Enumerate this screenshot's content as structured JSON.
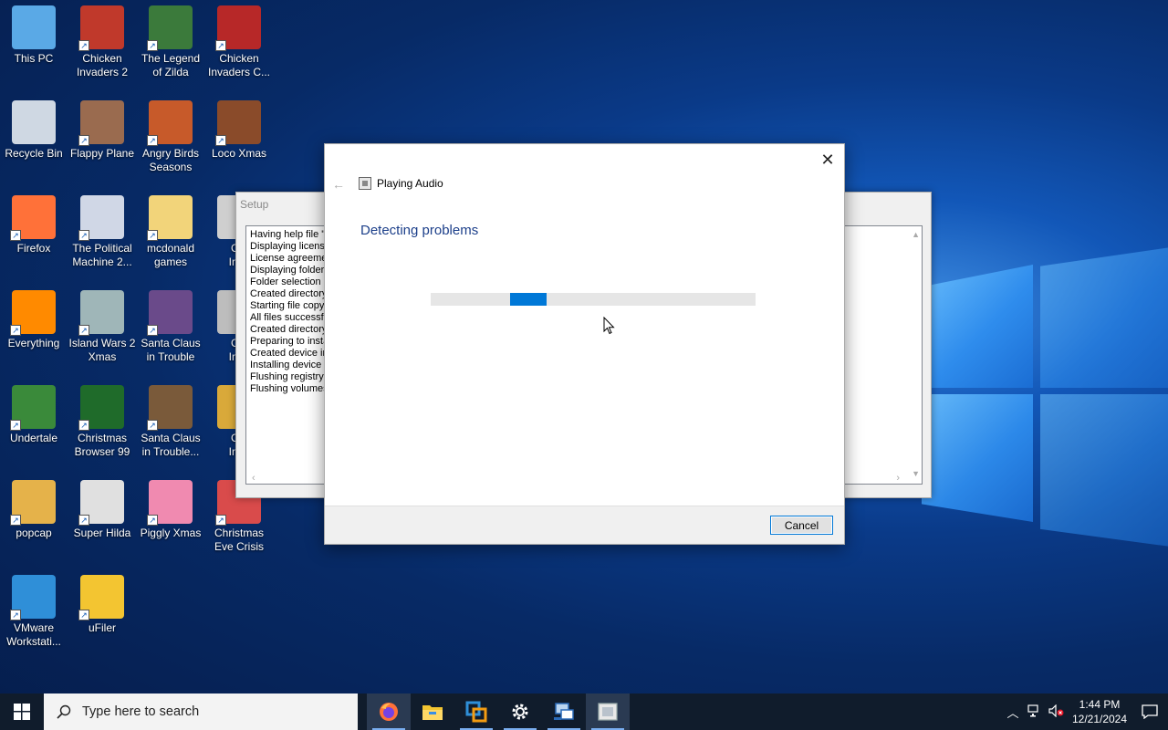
{
  "desktop": {
    "icons": [
      {
        "label": "This PC",
        "icon": "computer-icon",
        "color": "#5aa9e6"
      },
      {
        "label": "Chicken Invaders 2",
        "icon": "chicken-game-icon",
        "color": "#c0392b"
      },
      {
        "label": "The Legend of Zilda",
        "icon": "zilda-game-icon",
        "color": "#3b7a3b"
      },
      {
        "label": "Chicken Invaders C...",
        "icon": "chicken-game-icon",
        "color": "#b72828"
      },
      {
        "label": "Recycle Bin",
        "icon": "recycle-bin-icon",
        "color": "#cfd8e3"
      },
      {
        "label": "Flappy Plane",
        "icon": "plane-game-icon",
        "color": "#9a6b4f"
      },
      {
        "label": "Angry Birds Seasons",
        "icon": "angry-birds-icon",
        "color": "#c75a2a"
      },
      {
        "label": "Loco Xmas",
        "icon": "bear-game-icon",
        "color": "#8a4b2a"
      },
      {
        "label": "Firefox",
        "icon": "firefox-icon",
        "color": "#ff7139"
      },
      {
        "label": "The Political Machine 2...",
        "icon": "political-game-icon",
        "color": "#d0d7e6"
      },
      {
        "label": "mcdonald games",
        "icon": "folder-icon",
        "color": "#f2d47a"
      },
      {
        "label": "Everything",
        "icon": "search-magnifier-icon",
        "color": "#ff8a00"
      },
      {
        "label": "Island Wars 2 Xmas",
        "icon": "island-game-icon",
        "color": "#9fb6b8"
      },
      {
        "label": "Santa Claus in Trouble",
        "icon": "santa-game-icon",
        "color": "#6a4a8a"
      },
      {
        "label": "Undertale",
        "icon": "undertale-icon",
        "color": "#3a8a3a"
      },
      {
        "label": "Christmas Browser 99",
        "icon": "xmas-tree-icon",
        "color": "#1f6b2a"
      },
      {
        "label": "Santa Claus in Trouble...",
        "icon": "santa-game-icon",
        "color": "#7a5a3a"
      },
      {
        "label": "popcap",
        "icon": "folder-icon",
        "color": "#e5b24a"
      },
      {
        "label": "Super Hilda",
        "icon": "hilda-game-icon",
        "color": "#e0e0e0"
      },
      {
        "label": "Piggly Xmas",
        "icon": "pig-game-icon",
        "color": "#f08ab0"
      },
      {
        "label": "Christmas Eve Crisis",
        "icon": "santa-game-icon",
        "color": "#d94b4b"
      },
      {
        "label": "VMware Workstati...",
        "icon": "vmware-icon",
        "color": "#2f8fd8"
      },
      {
        "label": "uFiler",
        "icon": "ufiler-folder-icon",
        "color": "#f3c531"
      }
    ],
    "partial_icons": [
      {
        "label": "Chi\nInva",
        "color": "#cfcfcf"
      },
      {
        "label": "Chi\nInva",
        "color": "#bdbdbd"
      },
      {
        "label": "Chi\nInva",
        "color": "#d9a93a"
      }
    ]
  },
  "setup_window": {
    "title": "Setup",
    "log_lines": [
      "Having help file \"\\",
      "Displaying license",
      "License agreemer",
      "Displaying folder",
      "Folder selection s",
      "Created directory",
      "Starting file copy",
      "All files successfu",
      "Created directory",
      "Preparing to insta",
      "Created device in",
      "Installing device c",
      "Flushing registry",
      "Flushing volumes"
    ]
  },
  "dialog": {
    "window_title": "Playing Audio",
    "heading": "Detecting problems",
    "cancel_label": "Cancel",
    "progress_state": "indeterminate",
    "accent_color": "#0078d7"
  },
  "taskbar": {
    "search_placeholder": "Type here to search",
    "apps": [
      "firefox-icon",
      "file-explorer-icon",
      "vmware-icon",
      "settings-gear-icon",
      "network-setup-icon",
      "troubleshooter-icon"
    ],
    "clock_time": "1:44 PM",
    "clock_date": "12/21/2024"
  }
}
